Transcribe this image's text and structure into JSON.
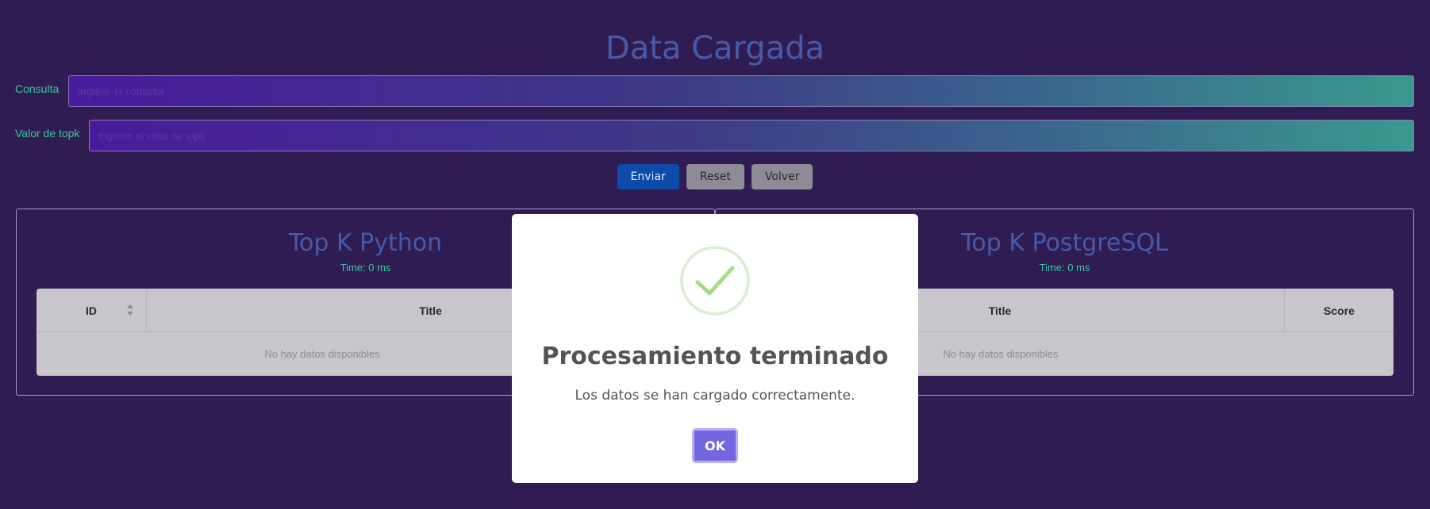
{
  "page": {
    "title": "Data Cargada"
  },
  "form": {
    "query": {
      "label": "Consulta",
      "placeholder": "Ingrese la consulta",
      "value": ""
    },
    "topk": {
      "label": "Valor de topk",
      "placeholder": "Ingrese el valor de topk",
      "value": ""
    }
  },
  "buttons": {
    "send": "Enviar",
    "reset": "Reset",
    "back": "Volver"
  },
  "panels": {
    "python": {
      "title": "Top K Python",
      "time": "Time: 0 ms",
      "columns": [
        "ID",
        "Title"
      ],
      "empty": "No hay datos disponibles"
    },
    "postgres": {
      "title": "Top K PostgreSQL",
      "time": "Time: 0 ms",
      "columns": [
        "Title",
        "Score"
      ],
      "empty": "No hay datos disponibles"
    }
  },
  "modal": {
    "icon": "check-icon",
    "title": "Procesamiento terminado",
    "text": "Los datos se han cargado correctamente.",
    "ok": "OK"
  },
  "colors": {
    "background": "#2f1c52",
    "title": "#4a5aa8",
    "accent": "#3ec6a6",
    "confirm": "#7367e0",
    "success": "#a5dc86"
  }
}
